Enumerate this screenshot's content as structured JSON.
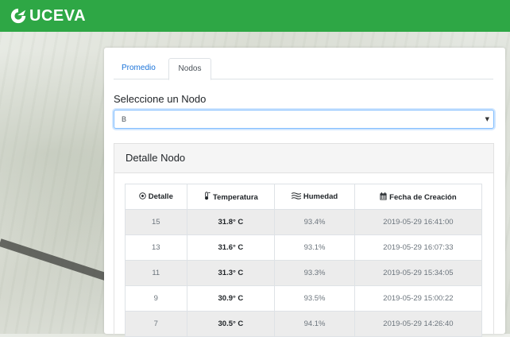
{
  "brand": {
    "name": "UCEVA"
  },
  "colors": {
    "topbar": "#2ea745",
    "tab_active_link": "#1a73d9",
    "row_stripe": "#ececec"
  },
  "tabs": [
    {
      "label": "Promedio",
      "active": false
    },
    {
      "label": "Nodos",
      "active": true
    }
  ],
  "selector": {
    "label": "Seleccione un Nodo",
    "value": "B"
  },
  "detail": {
    "title": "Detalle Nodo",
    "columns": [
      {
        "label": "Detalle",
        "icon": "target-icon"
      },
      {
        "label": "Temperatura",
        "icon": "thermometer-icon"
      },
      {
        "label": "Humedad",
        "icon": "humidity-lines-icon"
      },
      {
        "label": "Fecha de Creación",
        "icon": "calendar-icon"
      }
    ],
    "rows": [
      {
        "detalle": "15",
        "temperatura": "31.8° C",
        "humedad": "93.4%",
        "fecha": "2019-05-29 16:41:00"
      },
      {
        "detalle": "13",
        "temperatura": "31.6° C",
        "humedad": "93.1%",
        "fecha": "2019-05-29 16:07:33"
      },
      {
        "detalle": "11",
        "temperatura": "31.3° C",
        "humedad": "93.3%",
        "fecha": "2019-05-29 15:34:05"
      },
      {
        "detalle": "9",
        "temperatura": "30.9° C",
        "humedad": "93.5%",
        "fecha": "2019-05-29 15:00:22"
      },
      {
        "detalle": "7",
        "temperatura": "30.5° C",
        "humedad": "94.1%",
        "fecha": "2019-05-29 14:26:40"
      }
    ]
  }
}
